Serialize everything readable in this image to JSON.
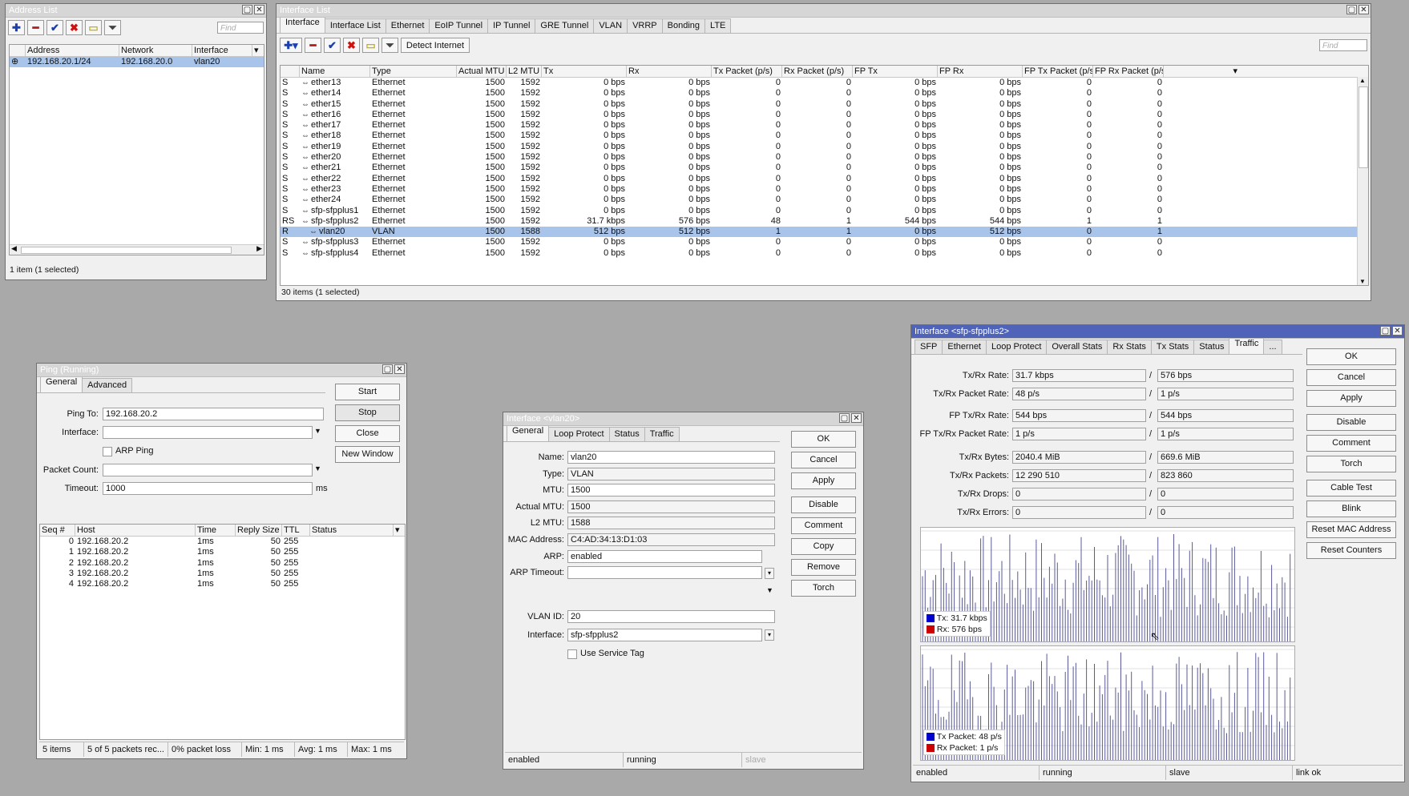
{
  "address_list": {
    "title": "Address List",
    "find_placeholder": "Find",
    "columns": [
      "Address",
      "Network",
      "Interface"
    ],
    "rows": [
      {
        "address": "192.168.20.1/24",
        "network": "192.168.20.0",
        "interface": "vlan20"
      }
    ],
    "status": "1 item (1 selected)"
  },
  "interface_list": {
    "title": "Interface List",
    "tabs": [
      "Interface",
      "Interface List",
      "Ethernet",
      "EoIP Tunnel",
      "IP Tunnel",
      "GRE Tunnel",
      "VLAN",
      "VRRP",
      "Bonding",
      "LTE"
    ],
    "detect_label": "Detect Internet",
    "find_placeholder": "Find",
    "columns": [
      "",
      "Name",
      "Type",
      "Actual MTU",
      "L2 MTU",
      "Tx",
      "Rx",
      "Tx Packet (p/s)",
      "Rx Packet (p/s)",
      "FP Tx",
      "FP Rx",
      "FP Tx Packet (p/s)",
      "FP Rx Packet (p/s)"
    ],
    "rows": [
      {
        "flag": "S",
        "name": "ether13",
        "type": "Ethernet",
        "amtu": "1500",
        "l2mtu": "1592",
        "tx": "0 bps",
        "rx": "0 bps",
        "txp": "0",
        "rxp": "0",
        "fptx": "0 bps",
        "fprx": "0 bps",
        "fptxp": "0",
        "fprxp": "0"
      },
      {
        "flag": "S",
        "name": "ether14",
        "type": "Ethernet",
        "amtu": "1500",
        "l2mtu": "1592",
        "tx": "0 bps",
        "rx": "0 bps",
        "txp": "0",
        "rxp": "0",
        "fptx": "0 bps",
        "fprx": "0 bps",
        "fptxp": "0",
        "fprxp": "0"
      },
      {
        "flag": "S",
        "name": "ether15",
        "type": "Ethernet",
        "amtu": "1500",
        "l2mtu": "1592",
        "tx": "0 bps",
        "rx": "0 bps",
        "txp": "0",
        "rxp": "0",
        "fptx": "0 bps",
        "fprx": "0 bps",
        "fptxp": "0",
        "fprxp": "0"
      },
      {
        "flag": "S",
        "name": "ether16",
        "type": "Ethernet",
        "amtu": "1500",
        "l2mtu": "1592",
        "tx": "0 bps",
        "rx": "0 bps",
        "txp": "0",
        "rxp": "0",
        "fptx": "0 bps",
        "fprx": "0 bps",
        "fptxp": "0",
        "fprxp": "0"
      },
      {
        "flag": "S",
        "name": "ether17",
        "type": "Ethernet",
        "amtu": "1500",
        "l2mtu": "1592",
        "tx": "0 bps",
        "rx": "0 bps",
        "txp": "0",
        "rxp": "0",
        "fptx": "0 bps",
        "fprx": "0 bps",
        "fptxp": "0",
        "fprxp": "0"
      },
      {
        "flag": "S",
        "name": "ether18",
        "type": "Ethernet",
        "amtu": "1500",
        "l2mtu": "1592",
        "tx": "0 bps",
        "rx": "0 bps",
        "txp": "0",
        "rxp": "0",
        "fptx": "0 bps",
        "fprx": "0 bps",
        "fptxp": "0",
        "fprxp": "0"
      },
      {
        "flag": "S",
        "name": "ether19",
        "type": "Ethernet",
        "amtu": "1500",
        "l2mtu": "1592",
        "tx": "0 bps",
        "rx": "0 bps",
        "txp": "0",
        "rxp": "0",
        "fptx": "0 bps",
        "fprx": "0 bps",
        "fptxp": "0",
        "fprxp": "0"
      },
      {
        "flag": "S",
        "name": "ether20",
        "type": "Ethernet",
        "amtu": "1500",
        "l2mtu": "1592",
        "tx": "0 bps",
        "rx": "0 bps",
        "txp": "0",
        "rxp": "0",
        "fptx": "0 bps",
        "fprx": "0 bps",
        "fptxp": "0",
        "fprxp": "0"
      },
      {
        "flag": "S",
        "name": "ether21",
        "type": "Ethernet",
        "amtu": "1500",
        "l2mtu": "1592",
        "tx": "0 bps",
        "rx": "0 bps",
        "txp": "0",
        "rxp": "0",
        "fptx": "0 bps",
        "fprx": "0 bps",
        "fptxp": "0",
        "fprxp": "0"
      },
      {
        "flag": "S",
        "name": "ether22",
        "type": "Ethernet",
        "amtu": "1500",
        "l2mtu": "1592",
        "tx": "0 bps",
        "rx": "0 bps",
        "txp": "0",
        "rxp": "0",
        "fptx": "0 bps",
        "fprx": "0 bps",
        "fptxp": "0",
        "fprxp": "0"
      },
      {
        "flag": "S",
        "name": "ether23",
        "type": "Ethernet",
        "amtu": "1500",
        "l2mtu": "1592",
        "tx": "0 bps",
        "rx": "0 bps",
        "txp": "0",
        "rxp": "0",
        "fptx": "0 bps",
        "fprx": "0 bps",
        "fptxp": "0",
        "fprxp": "0"
      },
      {
        "flag": "S",
        "name": "ether24",
        "type": "Ethernet",
        "amtu": "1500",
        "l2mtu": "1592",
        "tx": "0 bps",
        "rx": "0 bps",
        "txp": "0",
        "rxp": "0",
        "fptx": "0 bps",
        "fprx": "0 bps",
        "fptxp": "0",
        "fprxp": "0"
      },
      {
        "flag": "S",
        "name": "sfp-sfpplus1",
        "type": "Ethernet",
        "amtu": "1500",
        "l2mtu": "1592",
        "tx": "0 bps",
        "rx": "0 bps",
        "txp": "0",
        "rxp": "0",
        "fptx": "0 bps",
        "fprx": "0 bps",
        "fptxp": "0",
        "fprxp": "0"
      },
      {
        "flag": "RS",
        "name": "sfp-sfpplus2",
        "type": "Ethernet",
        "amtu": "1500",
        "l2mtu": "1592",
        "tx": "31.7 kbps",
        "rx": "576 bps",
        "txp": "48",
        "rxp": "1",
        "fptx": "544 bps",
        "fprx": "544 bps",
        "fptxp": "1",
        "fprxp": "1"
      },
      {
        "flag": "R",
        "name": "vlan20",
        "type": "VLAN",
        "amtu": "1500",
        "l2mtu": "1588",
        "tx": "512 bps",
        "rx": "512 bps",
        "txp": "1",
        "rxp": "1",
        "fptx": "0 bps",
        "fprx": "512 bps",
        "fptxp": "0",
        "fprxp": "1",
        "selected": true,
        "indent": true
      },
      {
        "flag": "S",
        "name": "sfp-sfpplus3",
        "type": "Ethernet",
        "amtu": "1500",
        "l2mtu": "1592",
        "tx": "0 bps",
        "rx": "0 bps",
        "txp": "0",
        "rxp": "0",
        "fptx": "0 bps",
        "fprx": "0 bps",
        "fptxp": "0",
        "fprxp": "0"
      },
      {
        "flag": "S",
        "name": "sfp-sfpplus4",
        "type": "Ethernet",
        "amtu": "1500",
        "l2mtu": "1592",
        "tx": "0 bps",
        "rx": "0 bps",
        "txp": "0",
        "rxp": "0",
        "fptx": "0 bps",
        "fprx": "0 bps",
        "fptxp": "0",
        "fprxp": "0"
      }
    ],
    "status": "30 items (1 selected)"
  },
  "ping": {
    "title": "Ping (Running)",
    "tabs": [
      "General",
      "Advanced"
    ],
    "ping_to_label": "Ping To:",
    "ping_to_value": "192.168.20.2",
    "interface_label": "Interface:",
    "arp_ping_label": "ARP Ping",
    "packet_count_label": "Packet Count:",
    "timeout_label": "Timeout:",
    "timeout_value": "1000",
    "timeout_unit": "ms",
    "buttons": {
      "start": "Start",
      "stop": "Stop",
      "close": "Close",
      "new_window": "New Window"
    },
    "columns": [
      "Seq #",
      "Host",
      "Time",
      "Reply Size",
      "TTL",
      "Status"
    ],
    "rows": [
      {
        "seq": "0",
        "host": "192.168.20.2",
        "time": "1ms",
        "size": "50",
        "ttl": "255",
        "status": ""
      },
      {
        "seq": "1",
        "host": "192.168.20.2",
        "time": "1ms",
        "size": "50",
        "ttl": "255",
        "status": ""
      },
      {
        "seq": "2",
        "host": "192.168.20.2",
        "time": "1ms",
        "size": "50",
        "ttl": "255",
        "status": ""
      },
      {
        "seq": "3",
        "host": "192.168.20.2",
        "time": "1ms",
        "size": "50",
        "ttl": "255",
        "status": ""
      },
      {
        "seq": "4",
        "host": "192.168.20.2",
        "time": "1ms",
        "size": "50",
        "ttl": "255",
        "status": ""
      }
    ],
    "statusbar": [
      "5 items",
      "5 of 5 packets rec...",
      "0% packet loss",
      "Min: 1 ms",
      "Avg: 1 ms",
      "Max: 1 ms"
    ]
  },
  "vlan": {
    "title": "Interface <vlan20>",
    "tabs": [
      "General",
      "Loop Protect",
      "Status",
      "Traffic"
    ],
    "fields": [
      {
        "label": "Name:",
        "value": "vlan20",
        "ro": false
      },
      {
        "label": "Type:",
        "value": "VLAN",
        "ro": true
      },
      {
        "label": "MTU:",
        "value": "1500",
        "ro": false
      },
      {
        "label": "Actual MTU:",
        "value": "1500",
        "ro": true
      },
      {
        "label": "L2 MTU:",
        "value": "1588",
        "ro": true
      },
      {
        "label": "MAC Address:",
        "value": "C4:AD:34:13:D1:03",
        "ro": true
      },
      {
        "label": "ARP:",
        "value": "enabled",
        "ro": false
      },
      {
        "label": "ARP Timeout:",
        "value": "",
        "ro": false
      }
    ],
    "vlan_id_label": "VLAN ID:",
    "vlan_id_value": "20",
    "interface_label": "Interface:",
    "interface_value": "sfp-sfpplus2",
    "service_tag_label": "Use Service Tag",
    "buttons": [
      "OK",
      "Cancel",
      "Apply",
      "Disable",
      "Comment",
      "Copy",
      "Remove",
      "Torch"
    ],
    "statusbar": [
      "enabled",
      "running",
      "slave"
    ]
  },
  "sfp": {
    "title": "Interface <sfp-sfpplus2>",
    "tabs": [
      "SFP",
      "Ethernet",
      "Loop Protect",
      "Overall Stats",
      "Rx Stats",
      "Tx Stats",
      "Status",
      "Traffic",
      "..."
    ],
    "rows": [
      {
        "label": "Tx/Rx Rate:",
        "a": "31.7 kbps",
        "b": "576 bps"
      },
      {
        "label": "Tx/Rx Packet Rate:",
        "a": "48 p/s",
        "b": "1 p/s"
      },
      {
        "label": "FP Tx/Rx Rate:",
        "a": "544 bps",
        "b": "544 bps"
      },
      {
        "label": "FP Tx/Rx Packet Rate:",
        "a": "1 p/s",
        "b": "1 p/s"
      },
      {
        "label": "Tx/Rx Bytes:",
        "a": "2040.4 MiB",
        "b": "669.6 MiB"
      },
      {
        "label": "Tx/Rx Packets:",
        "a": "12 290 510",
        "b": "823 860"
      },
      {
        "label": "Tx/Rx Drops:",
        "a": "0",
        "b": "0"
      },
      {
        "label": "Tx/Rx Errors:",
        "a": "0",
        "b": "0"
      }
    ],
    "graph1_legend": {
      "tx": "Tx:  31.7 kbps",
      "rx": "Rx:  576 bps"
    },
    "graph2_legend": {
      "tx": "Tx Packet:  48 p/s",
      "rx": "Rx Packet:  1 p/s"
    },
    "colors": {
      "tx": "#0000cc",
      "rx": "#cc0000",
      "bars": "#5a5a9a"
    },
    "buttons": [
      "OK",
      "Cancel",
      "Apply",
      "Disable",
      "Comment",
      "Torch",
      "Cable Test",
      "Blink",
      "Reset MAC Address",
      "Reset Counters"
    ],
    "statusbar": [
      "enabled",
      "running",
      "slave",
      "link ok"
    ]
  }
}
